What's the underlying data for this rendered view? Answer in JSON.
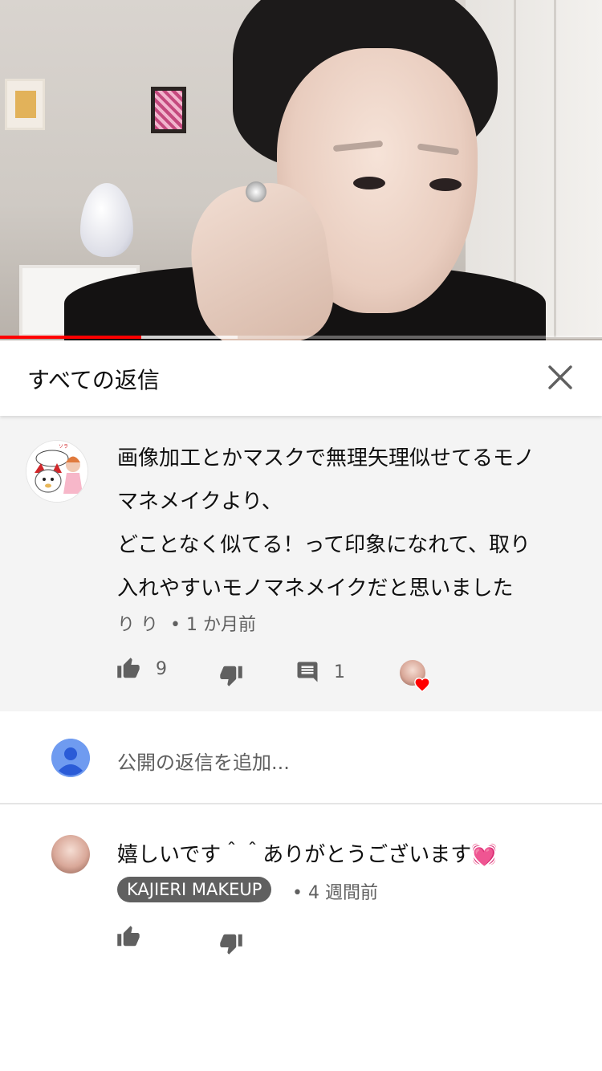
{
  "video": {
    "progress_played": 0.235,
    "progress_buffered": 0.395,
    "accent_color": "#ff0000"
  },
  "header": {
    "title": "すべての返信",
    "close_icon": "close-icon"
  },
  "parent_comment": {
    "lines": [
      "画像加工とかマスクで無理矢理似せてるモノ",
      "マネメイクより、",
      "どことなく似てる！って印象になれて、取り",
      "入れやすいモノマネメイクだと思いました"
    ],
    "author": "り り",
    "time": "• 1 か月前",
    "likes": "9",
    "replies": "1"
  },
  "reply_box": {
    "placeholder": "公開の返信を追加..."
  },
  "reply": {
    "text": "嬉しいです＾＾ありがとうございます💓",
    "author": "KAJIERI MAKEUP",
    "time": "• 4 週間前"
  },
  "colors": {
    "heart": "#ff0000",
    "badge_bg": "#606060",
    "icon_gray": "#606060"
  }
}
